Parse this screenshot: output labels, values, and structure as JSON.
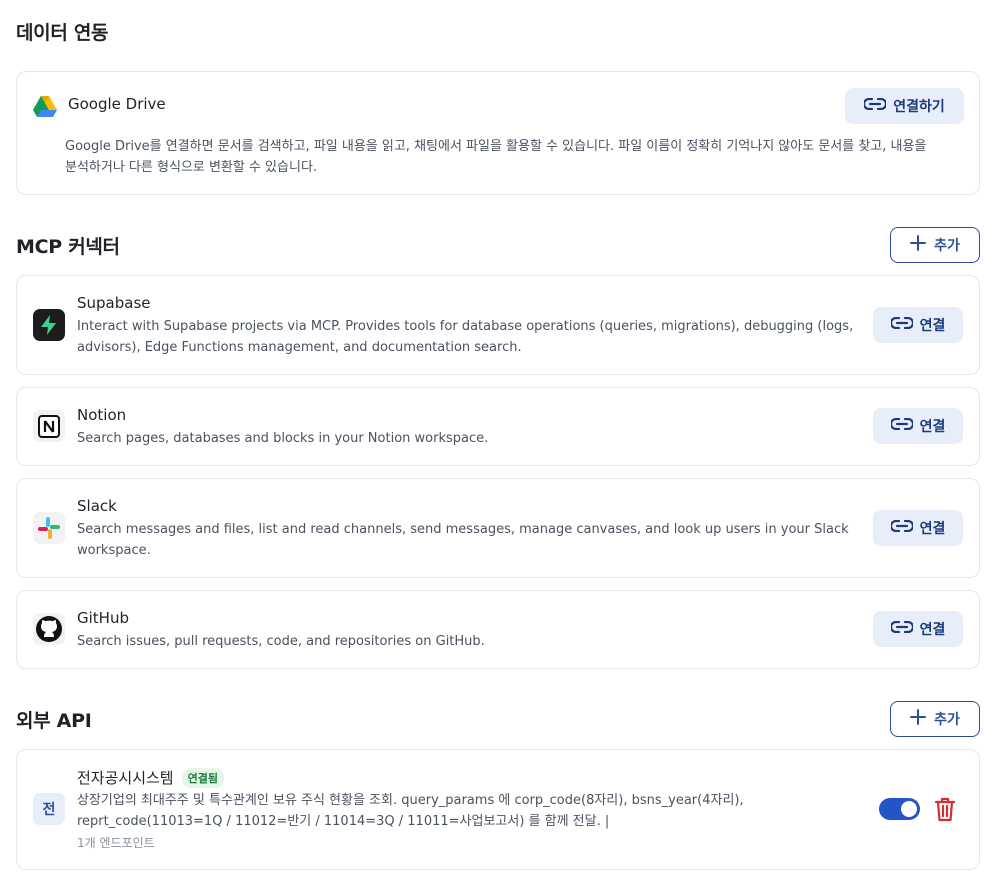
{
  "data_section": {
    "title": "데이터 연동",
    "google_drive": {
      "name": "Google Drive",
      "connect_label": "연결하기",
      "description": "Google Drive를 연결하면 문서를 검색하고, 파일 내용을 읽고, 채팅에서 파일을 활용할 수 있습니다. 파일 이름이 정확히 기억나지 않아도 문서를 찾고, 내용을 분석하거나 다른 형식으로 변환할 수 있습니다."
    }
  },
  "mcp_section": {
    "title": "MCP 커넥터",
    "add_label": "추가",
    "connectors": [
      {
        "name": "Supabase",
        "description": "Interact with Supabase projects via MCP. Provides tools for database operations (queries, migrations), debugging (logs, advisors), Edge Functions management, and documentation search.",
        "connect_label": "연결"
      },
      {
        "name": "Notion",
        "description": "Search pages, databases and blocks in your Notion workspace.",
        "connect_label": "연결"
      },
      {
        "name": "Slack",
        "description": "Search messages and files, list and read channels, send messages, manage canvases, and look up users in your Slack workspace.",
        "connect_label": "연결"
      },
      {
        "name": "GitHub",
        "description": "Search issues, pull requests, code, and repositories on GitHub.",
        "connect_label": "연결"
      }
    ]
  },
  "api_section": {
    "title": "외부 API",
    "add_label": "추가",
    "items": [
      {
        "avatar": "전",
        "name": "전자공시시스템",
        "status": "연결됨",
        "description": "상장기업의 최대주주 및 특수관계인 보유 주식 현황을 조회. query_params 에 corp_code(8자리), bsns_year(4자리), reprt_code(11013=1Q / 11012=반기 / 11014=3Q / 11011=사업보고서) 를 함께 전달. |",
        "endpoints": "1개 엔드포인트",
        "enabled": true
      }
    ]
  },
  "colors": {
    "accent": "#2c4f9c",
    "connect_bg": "#e8eef9",
    "toggle_on": "#2355c7",
    "delete": "#d32f2f",
    "badge_text": "#1d7a3a",
    "badge_bg": "#e6f6ea"
  },
  "icons": {
    "link": "link-icon",
    "plus": "plus-icon",
    "trash": "trash-icon"
  }
}
